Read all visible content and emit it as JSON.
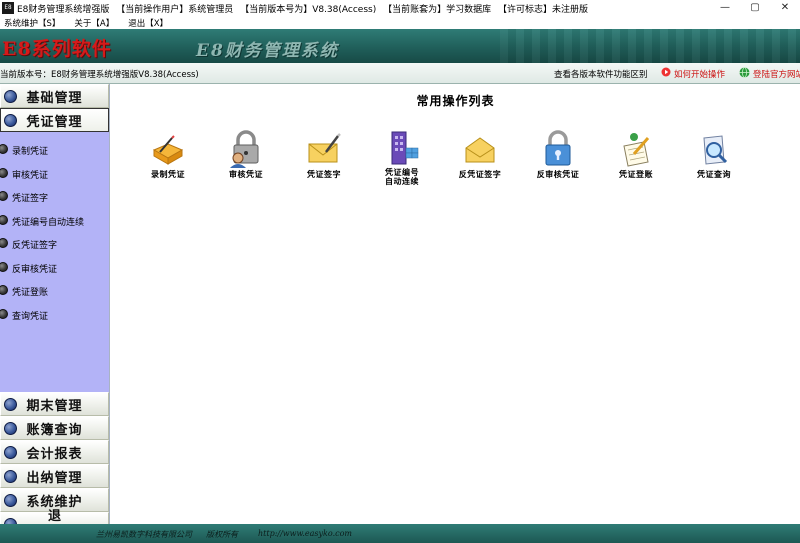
{
  "window": {
    "app_icon_text": "E8",
    "title_parts": [
      "E8财务管理系统增强版",
      "【当前操作用户】系统管理员",
      "【当前版本号为】V8.38(Access)",
      "【当前账套为】学习数据库",
      "【许可标志】未注册版"
    ],
    "minimize": "—",
    "maximize": "▢",
    "close": "✕"
  },
  "menubar": {
    "items": [
      "系统维护【S】",
      "关于【A】",
      "退出【X】"
    ]
  },
  "banner": {
    "logo": "E8系列软件",
    "product": "E8财务管理系统"
  },
  "infobar": {
    "version": "当前版本号：E8财务管理系统增强版V8.38(Access)",
    "compare": "查看各版本软件功能区别",
    "howto": "如何开始操作",
    "website": "登陆官方网站"
  },
  "sidebar": {
    "categories_top": [
      {
        "label": "基础管理"
      },
      {
        "label": "凭证管理"
      }
    ],
    "subitems": [
      "录制凭证",
      "审核凭证",
      "凭证签字",
      "凭证编号自动连续",
      "反凭证签字",
      "反审核凭证",
      "凭证登账",
      "查询凭证"
    ],
    "categories_bottom": [
      {
        "label": "期末管理"
      },
      {
        "label": "账簿查询"
      },
      {
        "label": "会计报表"
      },
      {
        "label": "出纳管理"
      },
      {
        "label": "系统维护"
      },
      {
        "label": "退出"
      }
    ]
  },
  "main": {
    "title": "常用操作列表",
    "operations": [
      {
        "label": "录制凭证",
        "icon": "pencil-folder-icon"
      },
      {
        "label": "审核凭证",
        "icon": "padlock-user-icon"
      },
      {
        "label": "凭证签字",
        "icon": "envelope-pen-icon"
      },
      {
        "label": "凭证编号\n自动连续",
        "icon": "building-grid-icon"
      },
      {
        "label": "反凭证签字",
        "icon": "envelope-icon"
      },
      {
        "label": "反审核凭证",
        "icon": "padlock-icon"
      },
      {
        "label": "凭证登账",
        "icon": "notepad-pen-icon"
      },
      {
        "label": "凭证查询",
        "icon": "magnifier-doc-icon"
      }
    ]
  },
  "statusbar": {
    "company": "兰州易凯数字科技有限公司",
    "rights": "版权所有",
    "url": "http://www.easyko.com"
  },
  "colors": {
    "banner": "#205f5a",
    "submenu": "#b3b3f7",
    "logo": "#d61a1a",
    "link": "#cc1010"
  }
}
